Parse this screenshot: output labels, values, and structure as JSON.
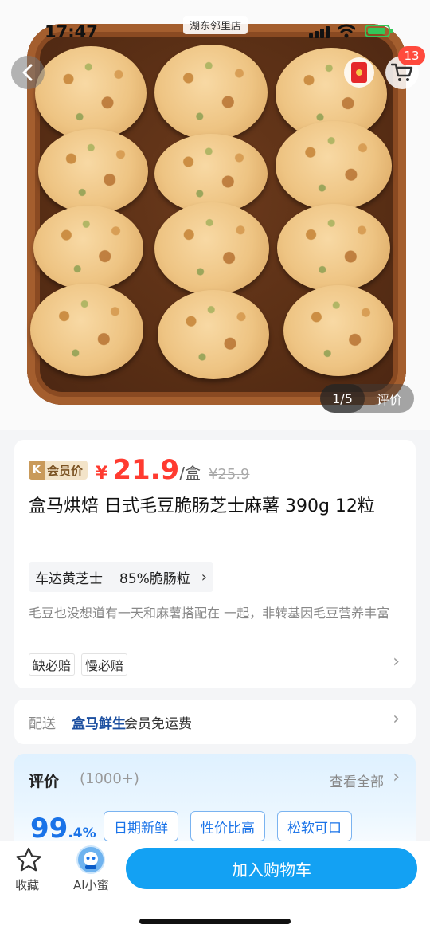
{
  "status": {
    "time": "17:47",
    "store": "湖东邻里店"
  },
  "nav": {
    "cart_count": "13"
  },
  "gallery": {
    "index": "1/5",
    "review_label": "评价"
  },
  "product": {
    "member_badge": "会员价",
    "currency": "¥",
    "price": "21.9",
    "unit": "/盒",
    "original_price": "¥25.9",
    "title": "盒马烘焙 日式毛豆脆肠芝士麻薯 390g 12粒",
    "specs": [
      "车达黄芝士",
      "85%脆肠粒"
    ],
    "description": "毛豆也没想道有一天和麻薯搭配在 一起，非转基因毛豆营养丰富",
    "promises": [
      "缺必赔",
      "慢必赔"
    ]
  },
  "shipping": {
    "label": "配送",
    "brand": "盒马鲜生",
    "text": "会员免运费"
  },
  "reviews": {
    "title": "评价",
    "count": "(1000+)",
    "see_all": "查看全部",
    "score": "99",
    "score_suffix": ".4%",
    "tags": [
      "日期新鲜",
      "性价比高",
      "松软可口"
    ]
  },
  "bottom": {
    "favorite": "收藏",
    "ai": "AI小蜜",
    "add_to_cart": "加入购物车"
  },
  "colors": {
    "price": "#ff3b30",
    "primary": "#13a1f3",
    "score": "#1a73e8"
  }
}
